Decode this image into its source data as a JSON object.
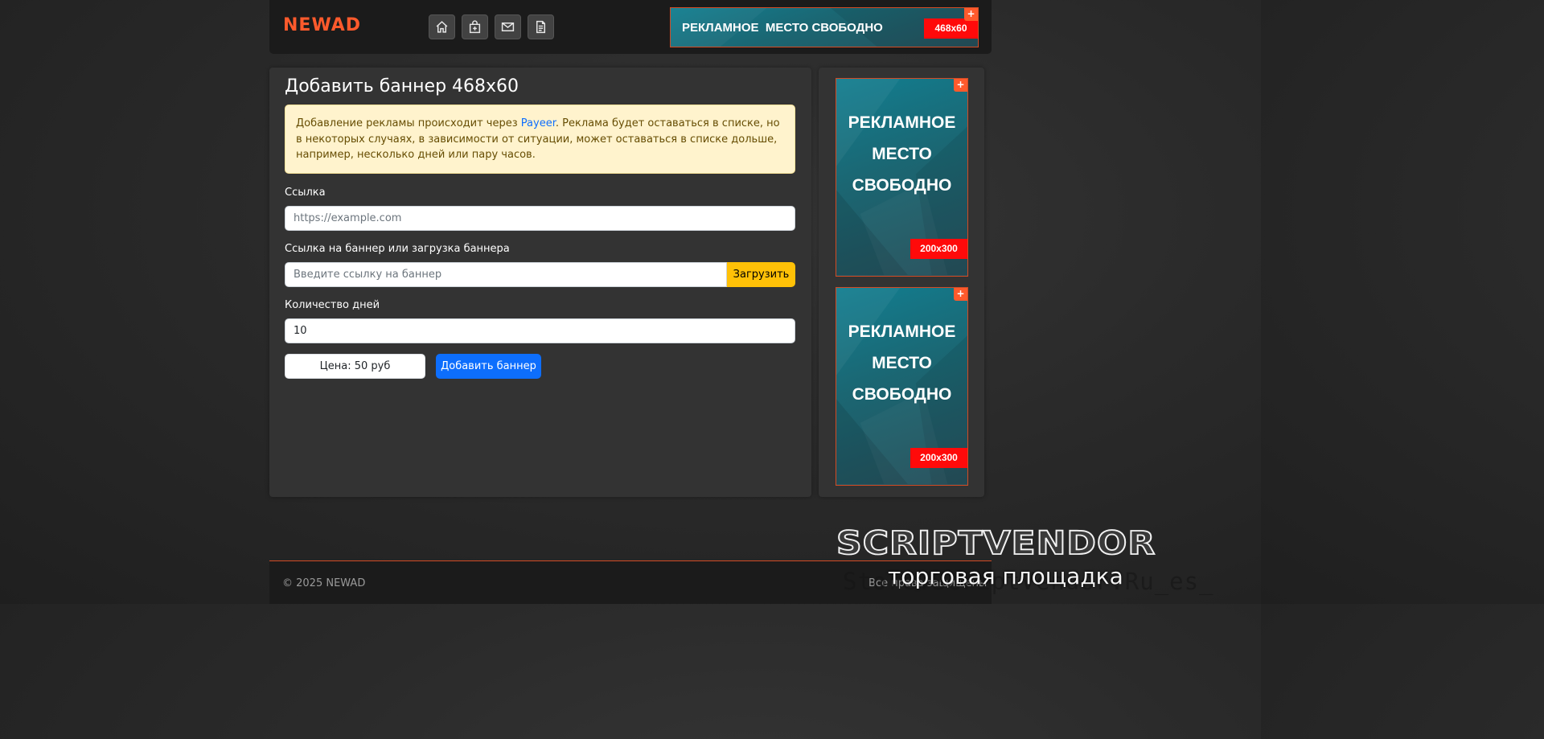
{
  "header": {
    "logo": "NEWAD",
    "nav": [
      "home-icon",
      "bag-plus-icon",
      "envelope-icon",
      "document-icon"
    ]
  },
  "ads": {
    "top": {
      "text": "РЕКЛАМНОЕ  МЕСТО СВОБОДНО",
      "size": "468x60",
      "plus": "+"
    },
    "side1": {
      "line1": "РЕКЛАМНОЕ",
      "line2": "МЕСТО",
      "line3": "СВОБОДНО",
      "size": "200x300",
      "plus": "+"
    },
    "side2": {
      "line1": "РЕКЛАМНОЕ",
      "line2": "МЕСТО",
      "line3": "СВОБОДНО",
      "size": "200x300",
      "plus": "+"
    },
    "colors": {
      "bg_start": "#127e90",
      "bg_end": "#264f5a",
      "badge": "#ff0a0a",
      "plus": "#ff5a2c"
    }
  },
  "main": {
    "title": "Добавить баннер 468x60",
    "alert": {
      "before": "Добавление рекламы происходит через ",
      "link": "Payeer",
      "after": ". Реклама будет оставаться в списке, но в некоторых случаях, в зависимости от ситуации, может оставаться в списке дольше, например, несколько дней или пару часов."
    },
    "link_label": "Ссылка",
    "link_placeholder": "https://example.com",
    "banner_label": "Ссылка на баннер или загрузка баннера",
    "banner_placeholder": "Введите ссылку на баннер",
    "upload_label": "Загрузить",
    "days_label": "Количество дней",
    "days_value": "10",
    "price": "Цена: 50 руб",
    "submit_label": "Добавить баннер"
  },
  "footer": {
    "copyright": "© 2025 NEWAD",
    "right": "Все права защищены"
  },
  "watermark": {
    "main": "SCRIPTVENDOR",
    "sub": "торговая площадка",
    "ghost": "Store.ScriptVendor.Ru_es_"
  },
  "colors": {
    "accent": "#ff5a2c",
    "primary": "#0d6efd",
    "warning": "#ffc107",
    "card_bg": "#333333",
    "header_bg": "#1b1b1b"
  }
}
